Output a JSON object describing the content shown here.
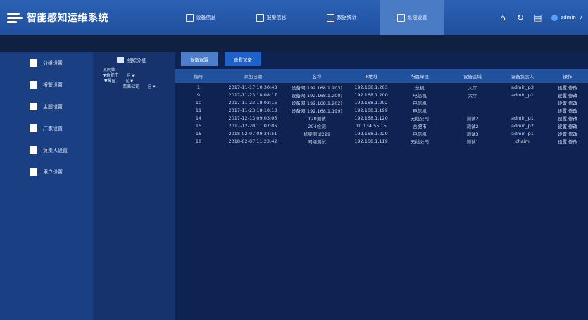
{
  "app": {
    "title": "智能感知运维系统"
  },
  "top_nav": [
    {
      "label": "设备信息"
    },
    {
      "label": "报警信息"
    },
    {
      "label": "数据统计"
    },
    {
      "label": "系统设置"
    }
  ],
  "top_right": {
    "user": "admin",
    "chevron": "∨"
  },
  "left_nav": [
    {
      "label": "分组设置"
    },
    {
      "label": "报警设置"
    },
    {
      "label": "主题设置"
    },
    {
      "label": "厂家设置"
    },
    {
      "label": "负责人设置"
    },
    {
      "label": "用户设置"
    }
  ],
  "tree": {
    "head": "组织分组",
    "rows": [
      {
        "text": "某网络",
        "extra": ""
      },
      {
        "text": "▼合肥市",
        "extra": "区 ▼"
      },
      {
        "text": "▼蜀区",
        "extra": "区 ▼"
      },
      {
        "text": "西南公司",
        "extra": "区 ▼"
      }
    ]
  },
  "buttons": {
    "tab1": "设备设置",
    "tab2": "查看设备"
  },
  "table": {
    "headers": [
      "编号",
      "添加日期",
      "名称",
      "IP地址",
      "所属单位",
      "设备区域",
      "设备负责人",
      "操作"
    ],
    "rows": [
      [
        "1",
        "2017-11-17 10:30:43",
        "设备网(192.168.1.203)",
        "192.168.1.203",
        "总机",
        "大厅",
        "admin_p3",
        [
          "设置",
          "修改"
        ]
      ],
      [
        "9",
        "2017-11-23 18:08:17",
        "设备网(192.168.1.200)",
        "192.168.1.200",
        "电信机",
        "大厅",
        "admin_p1",
        [
          "设置",
          "修改"
        ]
      ],
      [
        "10",
        "2017-11-23 18:03:15",
        "设备网(192.168.1.202)",
        "192.168.1.202",
        "电信机",
        "",
        "",
        [
          "设置",
          "修改"
        ]
      ],
      [
        "11",
        "2017-11-23 18:10:13",
        "设备网(192.168.1.199)",
        "192.168.1.199",
        "电信机",
        "",
        "",
        [
          "设置",
          "修改"
        ]
      ],
      [
        "14",
        "2017-12-13 09:03:05",
        "120测试",
        "192.168.1.120",
        "无线公司",
        "测试2",
        "admin_p1",
        [
          "设置",
          "修改"
        ]
      ],
      [
        "15",
        "2017-12-20 11:07:05",
        "204检测",
        "10.134.55.15",
        "合肥市",
        "测试2",
        "admin_p2",
        [
          "设置",
          "修改"
        ]
      ],
      [
        "16",
        "2018-02-07 09:34:51",
        "机架测试229",
        "192.168.1.229",
        "电信机",
        "测试3",
        "admin_p1",
        [
          "设置",
          "修改"
        ]
      ],
      [
        "18",
        "2018-02-07 11:23:42",
        "网络测试",
        "192.168.1.119",
        "无线公司",
        "测试1",
        "chaim",
        [
          "设置",
          "修改"
        ]
      ]
    ]
  },
  "colors": {
    "header_bg": "#2c61b4",
    "nav_active": "#4a7cc6",
    "leftnav_bg": "#1a3f82",
    "tree_bg": "#16336d",
    "main_bg": "#0e2352",
    "table_head": "#21509c"
  }
}
